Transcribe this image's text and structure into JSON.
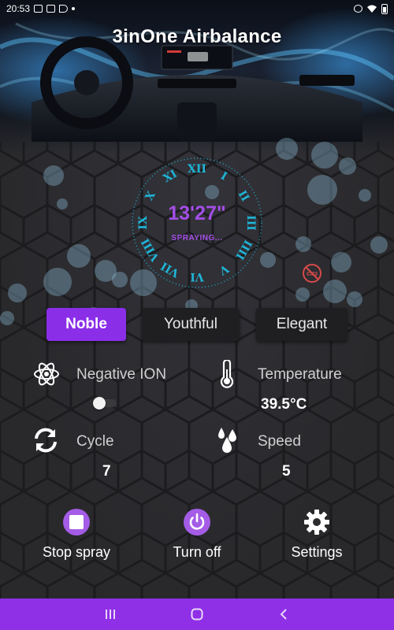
{
  "status_bar": {
    "time": "20:53",
    "left_icons": [
      "calendar-icon",
      "youtube-icon",
      "play-store-icon",
      "notification-dot-icon"
    ],
    "right_icons": [
      "alarm-icon",
      "wifi-icon",
      "battery-icon"
    ]
  },
  "header": {
    "title": "3inOne Airbalance"
  },
  "clock": {
    "time": "13'27\"",
    "status": "SPRAYING...",
    "numerals": [
      "XII",
      "I",
      "II",
      "III",
      "IIII",
      "V",
      "VI",
      "VII",
      "VIII",
      "IX",
      "X",
      "XI"
    ],
    "accent_color": "#1fb5d8",
    "text_color": "#a34ee6"
  },
  "no_smoking": {
    "icon": "no-smoking-icon",
    "color": "#d84a4a"
  },
  "modes": {
    "items": [
      {
        "label": "Noble",
        "active": true
      },
      {
        "label": "Youthful",
        "active": false
      },
      {
        "label": "Elegant",
        "active": false
      }
    ],
    "active_color": "#8a2ee8"
  },
  "info": {
    "negative_ion": {
      "label": "Negative ION",
      "icon": "atom-icon",
      "toggle_on": false
    },
    "temperature": {
      "label": "Temperature",
      "value": "39.5°C",
      "icon": "thermometer-icon"
    },
    "cycle": {
      "label": "Cycle",
      "value": "7",
      "icon": "cycle-icon"
    },
    "speed": {
      "label": "Speed",
      "value": "5",
      "icon": "drops-icon"
    }
  },
  "actions": {
    "stop_spray": {
      "label": "Stop spray",
      "icon": "stop-icon"
    },
    "turn_off": {
      "label": "Turn off",
      "icon": "power-icon"
    },
    "settings": {
      "label": "Settings",
      "icon": "gear-icon"
    }
  },
  "navbar": {
    "color": "#8f2fe6",
    "buttons": [
      "recent-apps-icon",
      "home-icon",
      "back-icon"
    ]
  }
}
